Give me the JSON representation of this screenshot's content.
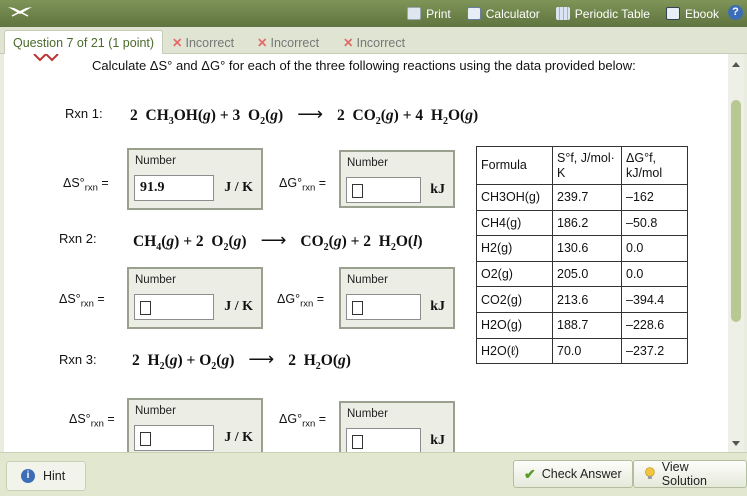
{
  "toolbar": {
    "print": "Print",
    "calculator": "Calculator",
    "periodic_table": "Periodic Table",
    "ebook": "Ebook"
  },
  "tabs": {
    "question": "Question 7 of 21 (1 point)",
    "attempt1": "Incorrect",
    "attempt2": "Incorrect",
    "attempt3": "Incorrect"
  },
  "instructions": "Calculate ΔS° and ΔG° for each of the three following reactions using the data provided below:",
  "reactions": [
    {
      "label": "Rxn 1:"
    },
    {
      "label": "Rxn 2:"
    },
    {
      "label": "Rxn 3:"
    }
  ],
  "entries": {
    "caption": "Number",
    "ds_label": "ΔS°",
    "dg_label": "ΔG°",
    "sub": "rxn",
    "eq": " =",
    "ds_unit": "J / K",
    "dg_unit": "kJ",
    "rxn1_ds_value": "91.9"
  },
  "table": {
    "headers": [
      "Formula",
      "S°f, J/mol· K",
      "ΔG°f, kJ/mol"
    ],
    "rows": [
      [
        "CH3OH(g)",
        "239.7",
        "–162"
      ],
      [
        "CH4(g)",
        "186.2",
        "–50.8"
      ],
      [
        "H2(g)",
        "130.6",
        "0.0"
      ],
      [
        "O2(g)",
        "205.0",
        "0.0"
      ],
      [
        "CO2(g)",
        "213.6",
        "–394.4"
      ],
      [
        "H2O(g)",
        "188.7",
        "–228.6"
      ],
      [
        "H2O(ℓ)",
        "70.0",
        "–237.2"
      ]
    ]
  },
  "footer": {
    "hint": "Hint",
    "check": "Check Answer",
    "solution": "View Solution"
  }
}
